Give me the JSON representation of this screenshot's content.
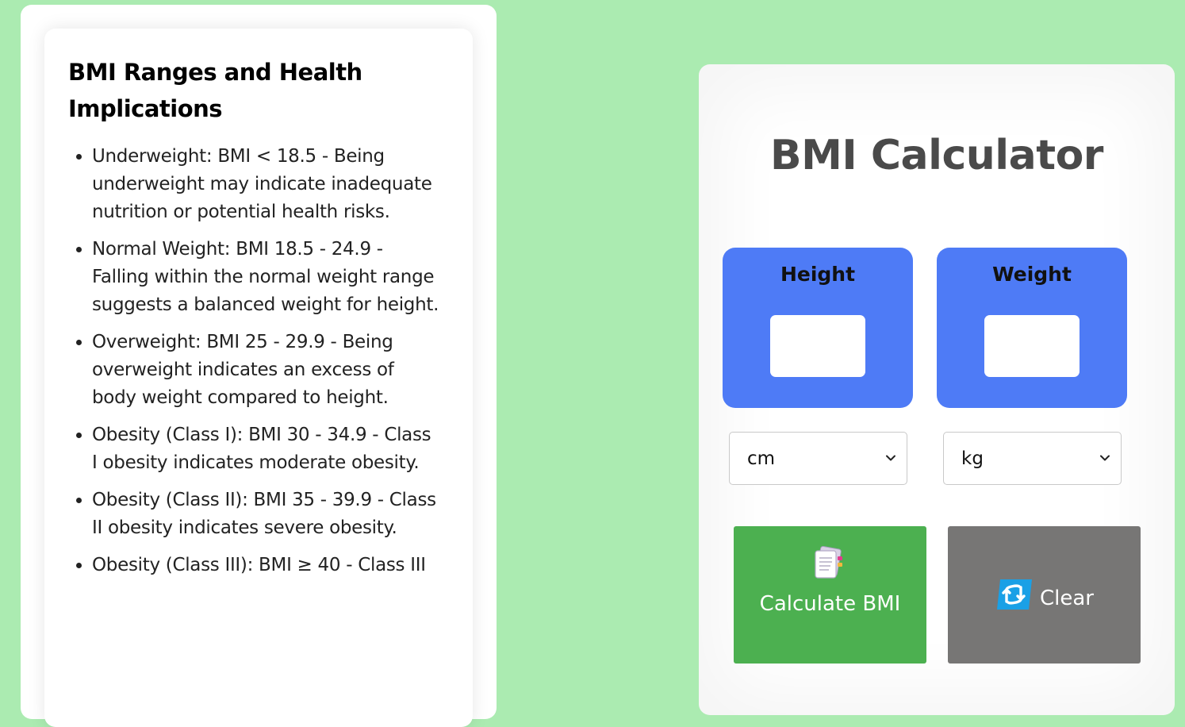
{
  "info": {
    "title": "BMI Ranges and Health Implications",
    "items": [
      "Underweight: BMI < 18.5 - Being underweight may indicate inadequate nutrition or potential health risks.",
      "Normal Weight: BMI 18.5 - 24.9 - Falling within the normal weight range suggests a balanced weight for height.",
      "Overweight: BMI 25 - 29.9 - Being overweight indicates an excess of body weight compared to height.",
      "Obesity (Class I): BMI 30 - 34.9 - Class I obesity indicates moderate obesity.",
      "Obesity (Class II): BMI 35 - 39.9 - Class II obesity indicates severe obesity.",
      "Obesity (Class III): BMI ≥ 40 - Class III"
    ]
  },
  "calculator": {
    "title": "BMI Calculator",
    "height_label": "Height",
    "weight_label": "Weight",
    "height_value": "",
    "weight_value": "",
    "height_unit": "cm",
    "weight_unit": "kg",
    "calculate_label": "Calculate BMI",
    "clear_label": "Clear",
    "icons": {
      "calculate": "document-notes-icon",
      "clear": "refresh-icon",
      "dropdown": "chevron-down-icon"
    }
  },
  "colors": {
    "page_background": "#abebb1",
    "input_box": "#4e7bf6",
    "calculate_button": "#4cb050",
    "clear_button": "#777675",
    "title_text": "#4a4a4a"
  }
}
